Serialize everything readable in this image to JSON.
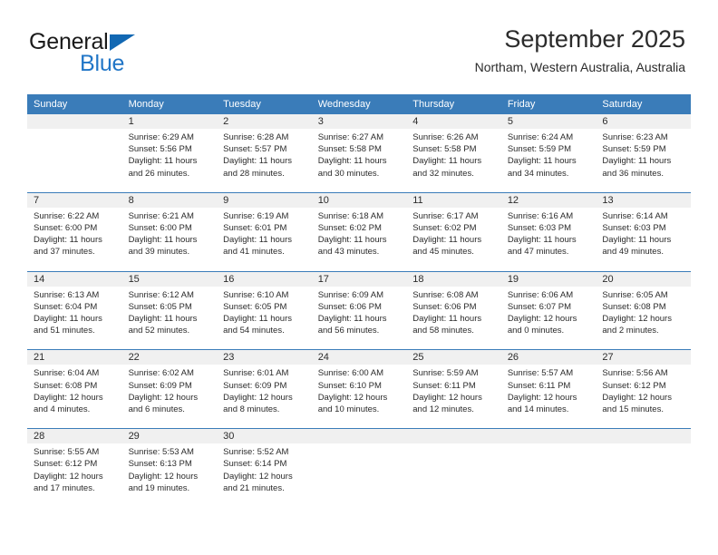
{
  "brand": {
    "line1": "General",
    "line2": "Blue",
    "triangle_color": "#1268b3",
    "blue_color": "#2176c7"
  },
  "header": {
    "title": "September 2025",
    "subtitle": "Northam, Western Australia, Australia"
  },
  "theme": {
    "header_blue": "#3a7cb9",
    "daynum_band": "#f0f0f0",
    "text": "#2b2b2b"
  },
  "weekday_headers": [
    "Sunday",
    "Monday",
    "Tuesday",
    "Wednesday",
    "Thursday",
    "Friday",
    "Saturday"
  ],
  "weeks": [
    [
      {
        "day": "",
        "sunrise": "",
        "sunset": "",
        "daylight": ""
      },
      {
        "day": "1",
        "sunrise": "Sunrise: 6:29 AM",
        "sunset": "Sunset: 5:56 PM",
        "daylight": "Daylight: 11 hours and 26 minutes."
      },
      {
        "day": "2",
        "sunrise": "Sunrise: 6:28 AM",
        "sunset": "Sunset: 5:57 PM",
        "daylight": "Daylight: 11 hours and 28 minutes."
      },
      {
        "day": "3",
        "sunrise": "Sunrise: 6:27 AM",
        "sunset": "Sunset: 5:58 PM",
        "daylight": "Daylight: 11 hours and 30 minutes."
      },
      {
        "day": "4",
        "sunrise": "Sunrise: 6:26 AM",
        "sunset": "Sunset: 5:58 PM",
        "daylight": "Daylight: 11 hours and 32 minutes."
      },
      {
        "day": "5",
        "sunrise": "Sunrise: 6:24 AM",
        "sunset": "Sunset: 5:59 PM",
        "daylight": "Daylight: 11 hours and 34 minutes."
      },
      {
        "day": "6",
        "sunrise": "Sunrise: 6:23 AM",
        "sunset": "Sunset: 5:59 PM",
        "daylight": "Daylight: 11 hours and 36 minutes."
      }
    ],
    [
      {
        "day": "7",
        "sunrise": "Sunrise: 6:22 AM",
        "sunset": "Sunset: 6:00 PM",
        "daylight": "Daylight: 11 hours and 37 minutes."
      },
      {
        "day": "8",
        "sunrise": "Sunrise: 6:21 AM",
        "sunset": "Sunset: 6:00 PM",
        "daylight": "Daylight: 11 hours and 39 minutes."
      },
      {
        "day": "9",
        "sunrise": "Sunrise: 6:19 AM",
        "sunset": "Sunset: 6:01 PM",
        "daylight": "Daylight: 11 hours and 41 minutes."
      },
      {
        "day": "10",
        "sunrise": "Sunrise: 6:18 AM",
        "sunset": "Sunset: 6:02 PM",
        "daylight": "Daylight: 11 hours and 43 minutes."
      },
      {
        "day": "11",
        "sunrise": "Sunrise: 6:17 AM",
        "sunset": "Sunset: 6:02 PM",
        "daylight": "Daylight: 11 hours and 45 minutes."
      },
      {
        "day": "12",
        "sunrise": "Sunrise: 6:16 AM",
        "sunset": "Sunset: 6:03 PM",
        "daylight": "Daylight: 11 hours and 47 minutes."
      },
      {
        "day": "13",
        "sunrise": "Sunrise: 6:14 AM",
        "sunset": "Sunset: 6:03 PM",
        "daylight": "Daylight: 11 hours and 49 minutes."
      }
    ],
    [
      {
        "day": "14",
        "sunrise": "Sunrise: 6:13 AM",
        "sunset": "Sunset: 6:04 PM",
        "daylight": "Daylight: 11 hours and 51 minutes."
      },
      {
        "day": "15",
        "sunrise": "Sunrise: 6:12 AM",
        "sunset": "Sunset: 6:05 PM",
        "daylight": "Daylight: 11 hours and 52 minutes."
      },
      {
        "day": "16",
        "sunrise": "Sunrise: 6:10 AM",
        "sunset": "Sunset: 6:05 PM",
        "daylight": "Daylight: 11 hours and 54 minutes."
      },
      {
        "day": "17",
        "sunrise": "Sunrise: 6:09 AM",
        "sunset": "Sunset: 6:06 PM",
        "daylight": "Daylight: 11 hours and 56 minutes."
      },
      {
        "day": "18",
        "sunrise": "Sunrise: 6:08 AM",
        "sunset": "Sunset: 6:06 PM",
        "daylight": "Daylight: 11 hours and 58 minutes."
      },
      {
        "day": "19",
        "sunrise": "Sunrise: 6:06 AM",
        "sunset": "Sunset: 6:07 PM",
        "daylight": "Daylight: 12 hours and 0 minutes."
      },
      {
        "day": "20",
        "sunrise": "Sunrise: 6:05 AM",
        "sunset": "Sunset: 6:08 PM",
        "daylight": "Daylight: 12 hours and 2 minutes."
      }
    ],
    [
      {
        "day": "21",
        "sunrise": "Sunrise: 6:04 AM",
        "sunset": "Sunset: 6:08 PM",
        "daylight": "Daylight: 12 hours and 4 minutes."
      },
      {
        "day": "22",
        "sunrise": "Sunrise: 6:02 AM",
        "sunset": "Sunset: 6:09 PM",
        "daylight": "Daylight: 12 hours and 6 minutes."
      },
      {
        "day": "23",
        "sunrise": "Sunrise: 6:01 AM",
        "sunset": "Sunset: 6:09 PM",
        "daylight": "Daylight: 12 hours and 8 minutes."
      },
      {
        "day": "24",
        "sunrise": "Sunrise: 6:00 AM",
        "sunset": "Sunset: 6:10 PM",
        "daylight": "Daylight: 12 hours and 10 minutes."
      },
      {
        "day": "25",
        "sunrise": "Sunrise: 5:59 AM",
        "sunset": "Sunset: 6:11 PM",
        "daylight": "Daylight: 12 hours and 12 minutes."
      },
      {
        "day": "26",
        "sunrise": "Sunrise: 5:57 AM",
        "sunset": "Sunset: 6:11 PM",
        "daylight": "Daylight: 12 hours and 14 minutes."
      },
      {
        "day": "27",
        "sunrise": "Sunrise: 5:56 AM",
        "sunset": "Sunset: 6:12 PM",
        "daylight": "Daylight: 12 hours and 15 minutes."
      }
    ],
    [
      {
        "day": "28",
        "sunrise": "Sunrise: 5:55 AM",
        "sunset": "Sunset: 6:12 PM",
        "daylight": "Daylight: 12 hours and 17 minutes."
      },
      {
        "day": "29",
        "sunrise": "Sunrise: 5:53 AM",
        "sunset": "Sunset: 6:13 PM",
        "daylight": "Daylight: 12 hours and 19 minutes."
      },
      {
        "day": "30",
        "sunrise": "Sunrise: 5:52 AM",
        "sunset": "Sunset: 6:14 PM",
        "daylight": "Daylight: 12 hours and 21 minutes."
      },
      {
        "day": "",
        "sunrise": "",
        "sunset": "",
        "daylight": ""
      },
      {
        "day": "",
        "sunrise": "",
        "sunset": "",
        "daylight": ""
      },
      {
        "day": "",
        "sunrise": "",
        "sunset": "",
        "daylight": ""
      },
      {
        "day": "",
        "sunrise": "",
        "sunset": "",
        "daylight": ""
      }
    ]
  ]
}
